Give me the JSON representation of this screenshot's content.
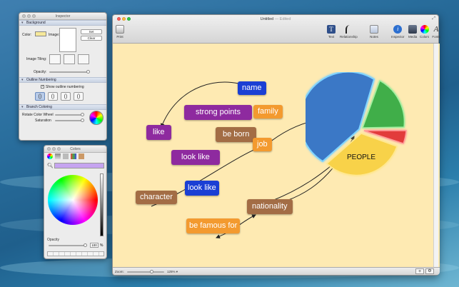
{
  "inspector": {
    "title": "Inspector",
    "background_section": "Background",
    "color_label": "Color:",
    "image_label": "Image:",
    "set_button": "Set",
    "clear_button": "Clear",
    "image_tiling_label": "Image Tiling:",
    "opacity_label": "Opacity:",
    "outline_section": "Outline Numbering",
    "show_numbering_label": "Show outline numbering",
    "branch_section": "Branch Coloring",
    "rotate_label": "Rotate Color Wheel",
    "saturation_label": "Saturation"
  },
  "colors_panel": {
    "title": "Colors",
    "opacity_label": "Opacity",
    "opacity_value": "100",
    "opacity_unit": "%"
  },
  "window": {
    "title": "Untitled",
    "edited": "— Edited",
    "toolbar": {
      "print": "Print",
      "text": "Text",
      "relationship": "Relationship",
      "notes": "Notes",
      "inspector": "Inspector",
      "media": "Media",
      "colors": "Colors",
      "fonts": "Fonts"
    },
    "zoom_label": "Zoom:",
    "zoom_value": "125% ▾"
  },
  "nodes": [
    {
      "text": "name",
      "color": "#1b3fd4"
    },
    {
      "text": "strong points",
      "color": "#8e2a9f"
    },
    {
      "text": "family",
      "color": "#f39a2f"
    },
    {
      "text": "like",
      "color": "#8e2a9f"
    },
    {
      "text": "be born",
      "color": "#a36d45"
    },
    {
      "text": "job",
      "color": "#f39a2f"
    },
    {
      "text": "look like",
      "color": "#8e2a9f"
    },
    {
      "text": "look like",
      "color": "#1b3fd4"
    },
    {
      "text": "character",
      "color": "#a36d45"
    },
    {
      "text": "nationality",
      "color": "#a36d45"
    },
    {
      "text": "be famous for",
      "color": "#f39a2f"
    }
  ],
  "pie": {
    "label": "PEOPLE",
    "colors": {
      "blue": "#3b78c6",
      "green": "#3fae4a",
      "red": "#e23a3a",
      "yellow": "#f8d24a"
    }
  }
}
